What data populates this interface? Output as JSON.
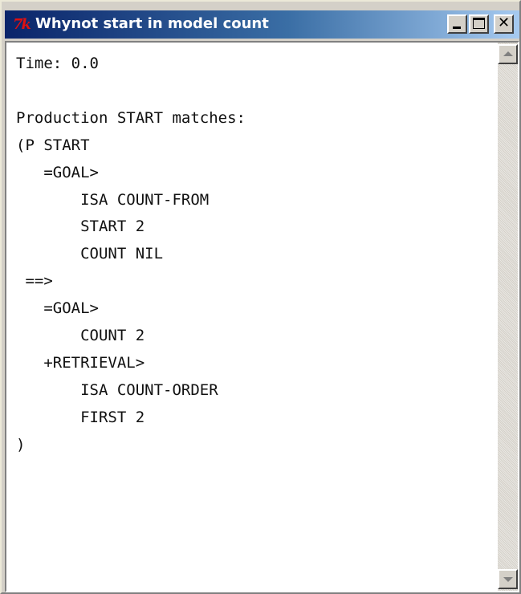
{
  "window": {
    "title": "Whynot start in model count",
    "icon": "tk-icon",
    "buttons": {
      "minimize": "minimize",
      "maximize": "maximize",
      "close": "close"
    }
  },
  "content": {
    "text": "Time: 0.0\n\nProduction START matches:\n(P START\n   =GOAL>\n       ISA COUNT-FROM\n       START 2\n       COUNT NIL\n ==>\n   =GOAL>\n       COUNT 2\n   +RETRIEVAL>\n       ISA COUNT-ORDER\n       FIRST 2\n)"
  },
  "colors": {
    "titlebar_start": "#0a246a",
    "titlebar_end": "#a6caf0",
    "chrome": "#d4d0c8",
    "text": "#111111"
  }
}
